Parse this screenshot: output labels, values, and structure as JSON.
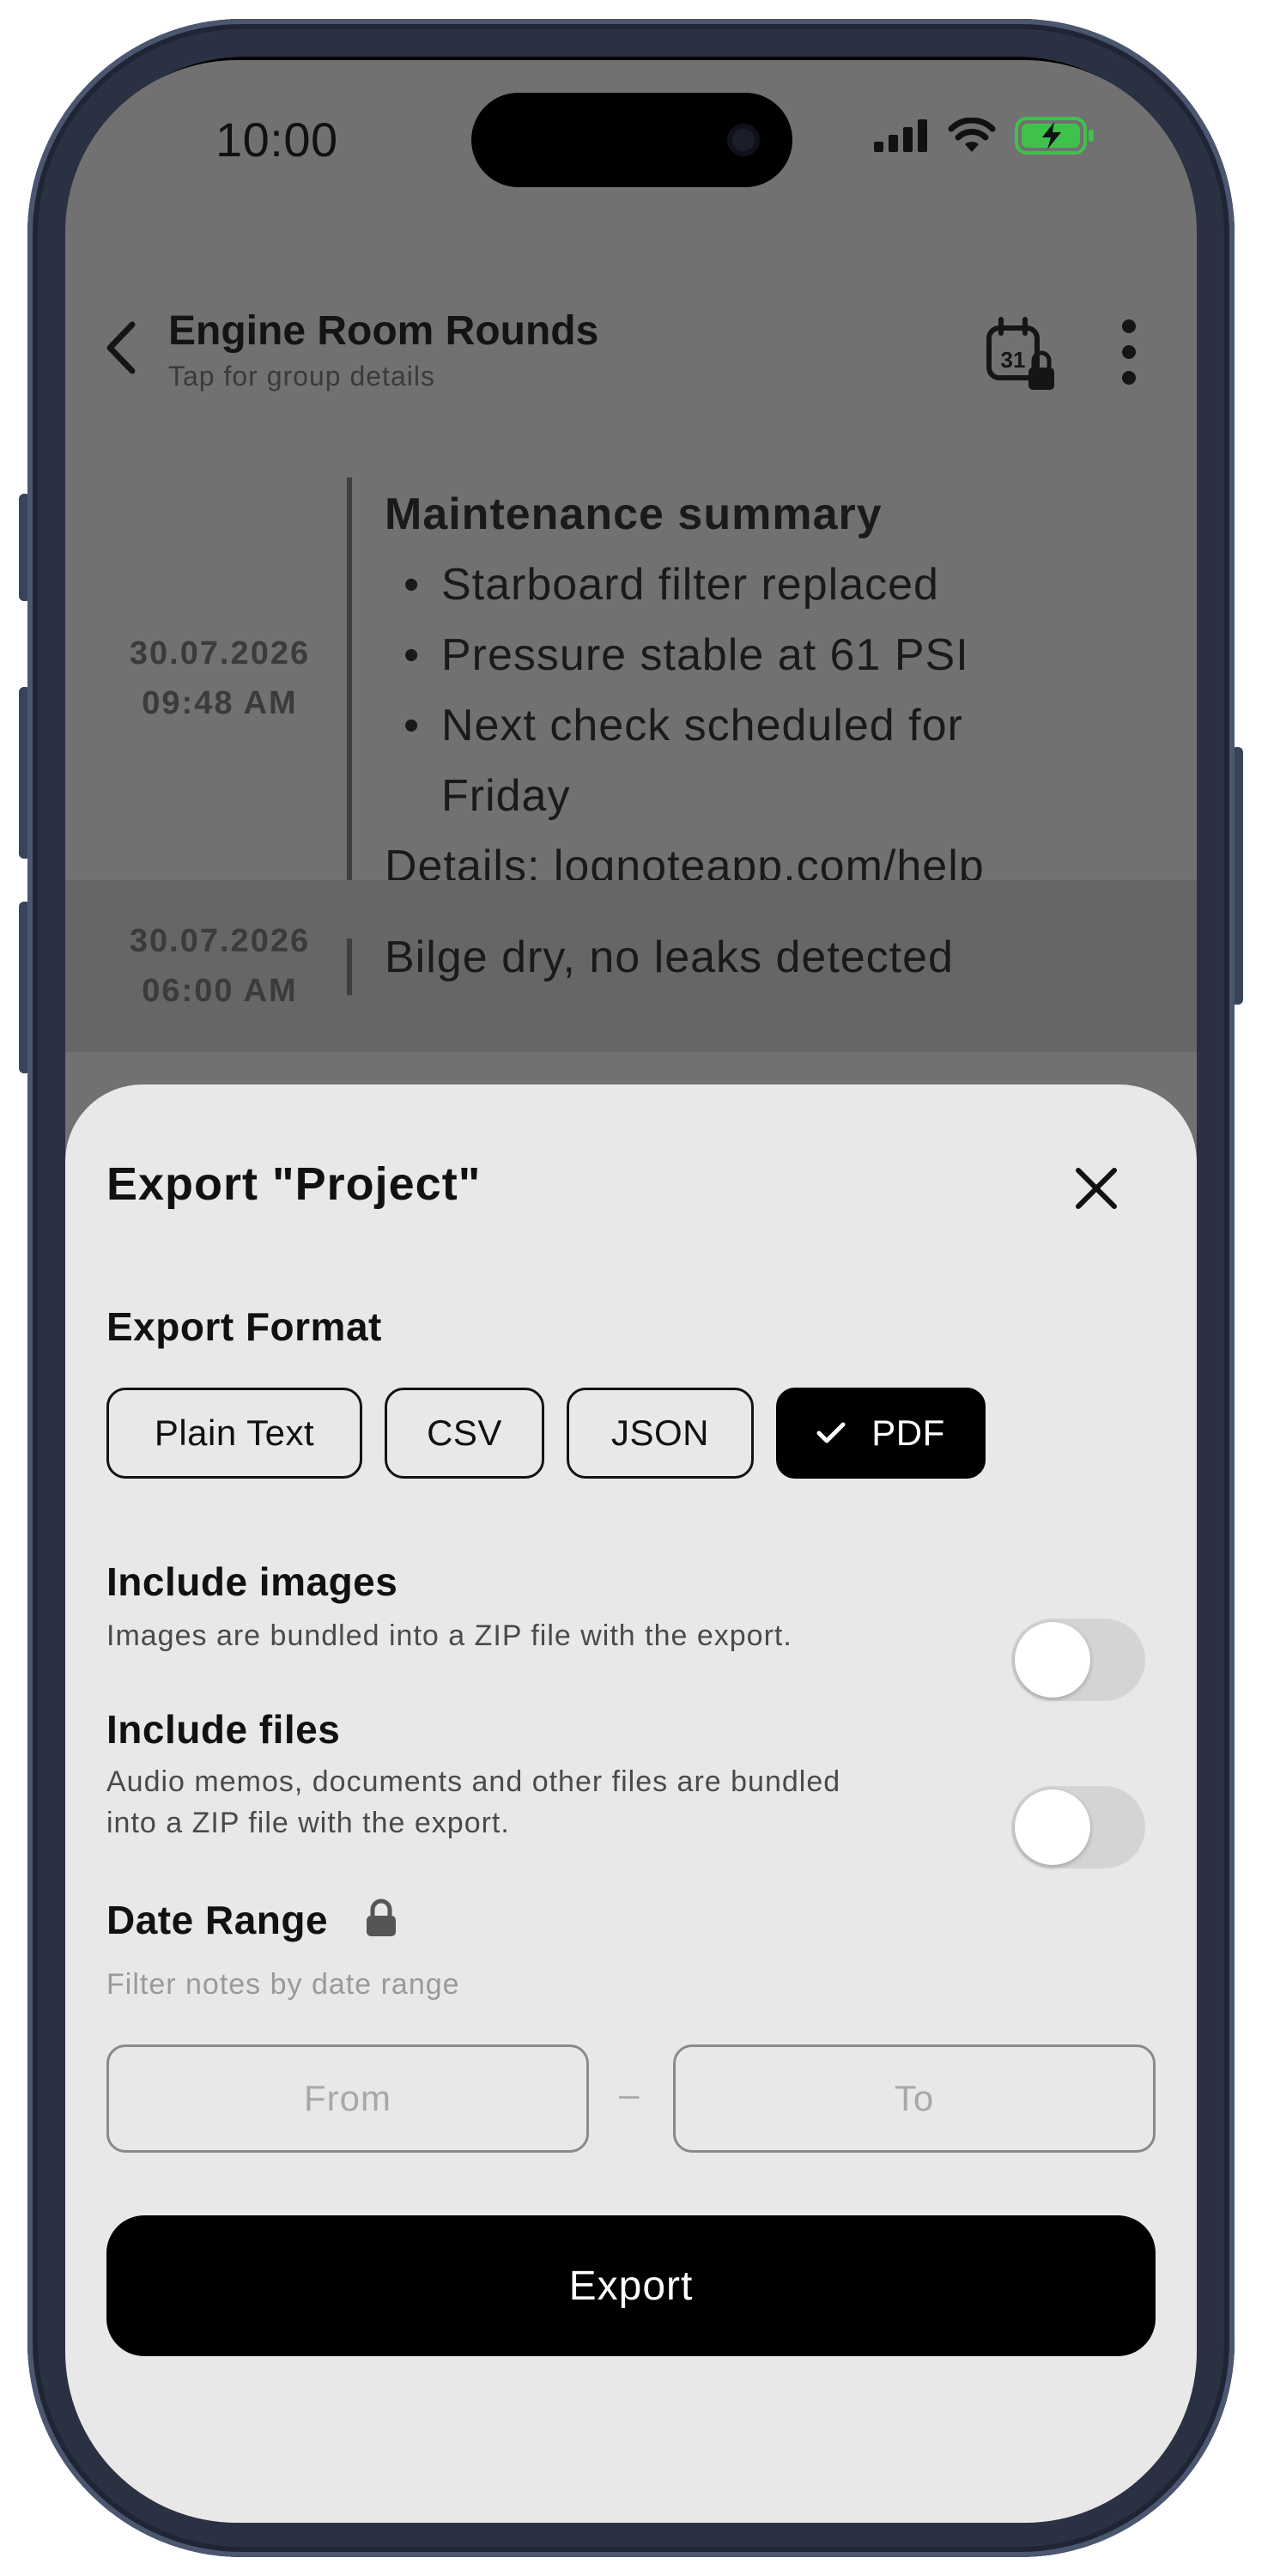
{
  "status_bar": {
    "time": "10:00"
  },
  "header": {
    "title": "Engine Room Rounds",
    "subtitle": "Tap for group details",
    "calendar_day": "31"
  },
  "notes": [
    {
      "date": "30.07.2026",
      "time": "09:48 AM",
      "heading": "Maintenance summary",
      "bullets": [
        "Starboard filter replaced",
        "Pressure stable at 61 PSI",
        "Next check scheduled for",
        "Friday"
      ],
      "details_label": "Details:",
      "details_link": "lognoteapp.com/help"
    },
    {
      "date": "30.07.2026",
      "time": "06:00 AM",
      "text": "Bilge dry, no leaks detected"
    }
  ],
  "sheet": {
    "title": "Export \"Project\"",
    "format_label": "Export Format",
    "formats": [
      "Plain Text",
      "CSV",
      "JSON",
      "PDF"
    ],
    "selected_format": "PDF",
    "include_images": {
      "label": "Include images",
      "description": "Images are bundled into a ZIP file with the export.",
      "enabled": false
    },
    "include_files": {
      "label": "Include files",
      "description_line1": "Audio memos, documents and other files are bundled",
      "description_line2": "into a ZIP file with the export.",
      "enabled": false
    },
    "date_range": {
      "label": "Date Range",
      "description": "Filter notes by date range",
      "from_placeholder": "From",
      "separator": "–",
      "to_placeholder": "To"
    },
    "export_button": "Export"
  },
  "colors": {
    "overlay": "#717171",
    "sheet": "#e8e8e8",
    "primary": "#000000",
    "battery": "#3ec24a"
  }
}
